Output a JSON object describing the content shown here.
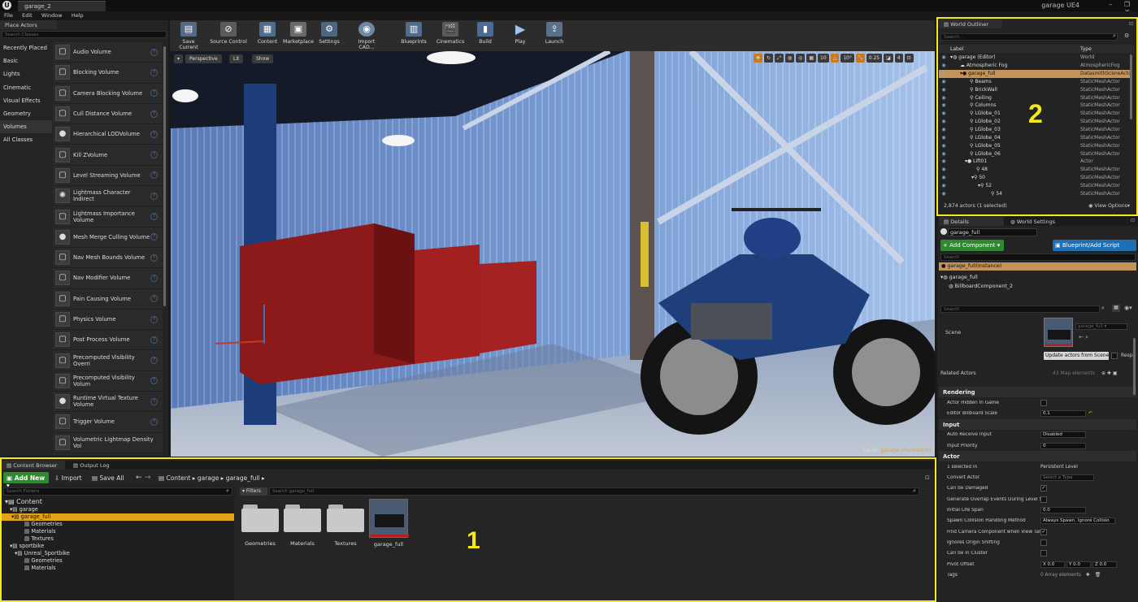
{
  "window": {
    "tab_title": "garage_2",
    "app_title": "garage UE4",
    "controls": "– ❐ ✕"
  },
  "menu": [
    "File",
    "Edit",
    "Window",
    "Help"
  ],
  "place_actors": {
    "tab_label": "Place Actors",
    "search_placeholder": "Search Classes",
    "categories": [
      "Recently Placed",
      "Basic",
      "Lights",
      "Cinematic",
      "Visual Effects",
      "Geometry",
      "Volumes",
      "All Classes"
    ],
    "selected_category": "Volumes",
    "items": [
      "Audio Volume",
      "Blocking Volume",
      "Camera Blocking Volume",
      "Cull Distance Volume",
      "Hierarchical LODVolume",
      "Kill ZVolume",
      "Level Streaming Volume",
      "Lightmass Character Indirect",
      "Lightmass Importance Volume",
      "Mesh Merge Culling Volume",
      "Nav Mesh Bounds Volume",
      "Nav Modifier Volume",
      "Pain Causing Volume",
      "Physics Volume",
      "Post Process Volume",
      "Precomputed Visibility Overri",
      "Precomputed Visibility Volum",
      "Runtime Virtual Texture Volume",
      "Trigger Volume",
      "Volumetric Lightmap Density Vol"
    ]
  },
  "toolbar": {
    "buttons": [
      "Save Current",
      "Source Control",
      "Content",
      "Marketplace",
      "Settings",
      "Import CAD...",
      "Blueprints",
      "Cinematics",
      "Build",
      "Play",
      "Launch"
    ]
  },
  "viewport": {
    "perspective": "Perspective",
    "lit": "Lit",
    "show": "Show",
    "grid_value": "10",
    "angle_value": "10°",
    "scale_value": "0.25",
    "cam_speed": "4",
    "level_prefix": "Level:",
    "level_name": "garage (Persistent)"
  },
  "content_browser": {
    "tab_label": "Content Browser",
    "output_tab_label": "Output Log",
    "add_new": "Add New",
    "import": "Import",
    "save_all": "Save All",
    "path": [
      "Content",
      "garage",
      "garage_full"
    ],
    "search_folders": "Search Folders",
    "filters": "Filters",
    "search_assets": "Search garage_full",
    "tree": [
      {
        "label": "Content",
        "indent": 0
      },
      {
        "label": "garage",
        "indent": 1
      },
      {
        "label": "garage_full",
        "indent": 2,
        "selected": true
      },
      {
        "label": "Geometries",
        "indent": 3
      },
      {
        "label": "Materials",
        "indent": 3
      },
      {
        "label": "Textures",
        "indent": 3
      },
      {
        "label": "sportbike",
        "indent": 1
      },
      {
        "label": "Unreal_Sportbike",
        "indent": 2
      },
      {
        "label": "Geometries",
        "indent": 3
      },
      {
        "label": "Materials",
        "indent": 3
      }
    ],
    "assets": [
      "Geometries",
      "Materials",
      "Textures",
      "garage_full"
    ],
    "annotation_number": "1"
  },
  "outliner": {
    "tab_label": "World Outliner",
    "search_placeholder": "Search...",
    "col_label": "Label",
    "col_type": "Type",
    "rows": [
      {
        "label": "garage (Editor)",
        "type": "World",
        "indent": 0
      },
      {
        "label": "Atmospheric Fog",
        "type": "AtmosphericFog",
        "indent": 1
      },
      {
        "label": "garage_full",
        "type": "DatasmithSceneActo",
        "indent": 1,
        "selected": true
      },
      {
        "label": "Beams",
        "type": "StaticMeshActor",
        "indent": 2
      },
      {
        "label": "BrickWall",
        "type": "StaticMeshActor",
        "indent": 2
      },
      {
        "label": "Ceiling",
        "type": "StaticMeshActor",
        "indent": 2
      },
      {
        "label": "Columns",
        "type": "StaticMeshActor",
        "indent": 2
      },
      {
        "label": "LGlobe_01",
        "type": "StaticMeshActor",
        "indent": 2
      },
      {
        "label": "LGlobe_02",
        "type": "StaticMeshActor",
        "indent": 2
      },
      {
        "label": "LGlobe_03",
        "type": "StaticMeshActor",
        "indent": 2
      },
      {
        "label": "LGlobe_04",
        "type": "StaticMeshActor",
        "indent": 2
      },
      {
        "label": "LGlobe_05",
        "type": "StaticMeshActor",
        "indent": 2
      },
      {
        "label": "LGlobe_06",
        "type": "StaticMeshActor",
        "indent": 2
      },
      {
        "label": "Lift01",
        "type": "Actor",
        "indent": 2
      },
      {
        "label": "48",
        "type": "StaticMeshActor",
        "indent": 3
      },
      {
        "label": "50",
        "type": "StaticMeshActor",
        "indent": 3
      },
      {
        "label": "52",
        "type": "StaticMeshActor",
        "indent": 4
      },
      {
        "label": "54",
        "type": "StaticMeshActor",
        "indent": 5
      }
    ],
    "status": "2,874 actors (1 selected)",
    "view_options": "View Options",
    "annotation_number": "2"
  },
  "details": {
    "tab_label": "Details",
    "world_settings_label": "World Settings",
    "name_value": "garage_full",
    "add_component": "+ Add Component",
    "blueprint_script": "Blueprint/Add Script",
    "search_placeholder": "Search",
    "instance_label": "garage_full(Instance)",
    "component_root": "garage_full",
    "component_child": "BillboardComponent_2",
    "search2_placeholder": "Search",
    "scene_label": "Scene",
    "scene_asset": "garage_full",
    "update_actors": "Update actors from Scene",
    "respawn": "Respa",
    "related_actors": "Related Actors",
    "related_value": "43 Map elements",
    "rendering": "Rendering",
    "actor_hidden": "Actor Hidden In Game",
    "billboard_scale": "Editor Billboard Scale",
    "billboard_value": "0.1",
    "input": "Input",
    "auto_receive": "Auto Receive Input",
    "auto_receive_value": "Disabled",
    "input_priority": "Input Priority",
    "input_priority_value": "0",
    "actor": "Actor",
    "selected_in": "1 selected in",
    "persistent_level": "Persistent Level",
    "convert_actor": "Convert Actor",
    "select_type": "Select a Type",
    "can_be_damaged": "Can be Damaged",
    "overlap_events": "Generate Overlap Events During Level Strea",
    "initial_life": "Initial Life Span",
    "initial_life_value": "0.0",
    "spawn_handling": "Spawn Collision Handling Method",
    "spawn_value": "Always Spawn, Ignore Collisio",
    "find_camera": "Find Camera Component when View Target",
    "ignores_origin": "Ignores Origin Shifting",
    "can_be_cluster": "Can be in Cluster",
    "pivot_offset": "Pivot Offset",
    "pivot_x": "X 0.0",
    "pivot_y": "Y 0.0",
    "pivot_z": "Z 0.0",
    "tags": "Tags",
    "tags_value": "0 Array elements"
  }
}
